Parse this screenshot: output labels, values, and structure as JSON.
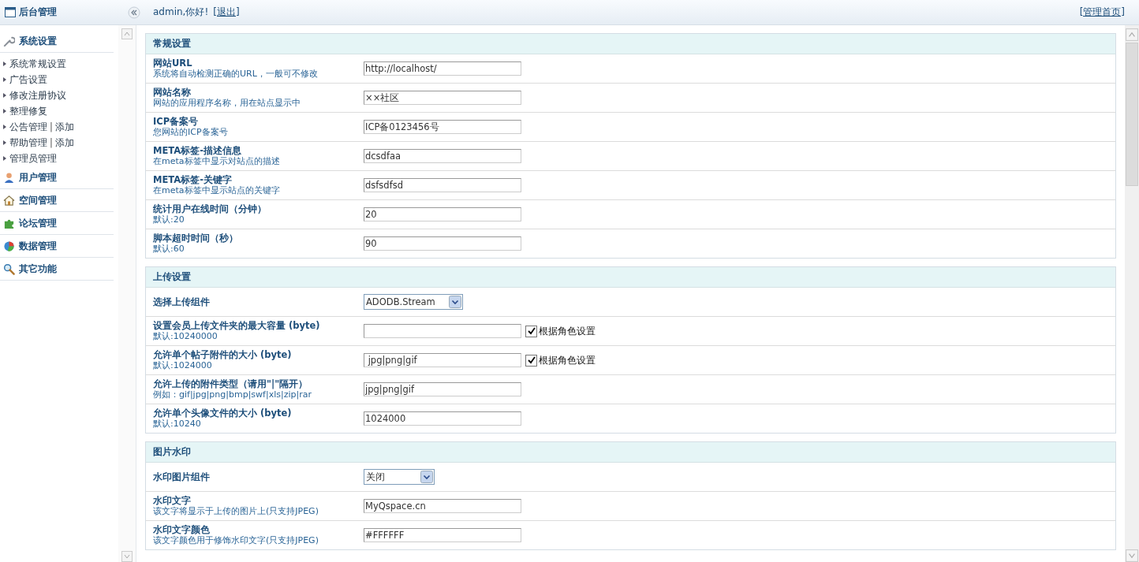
{
  "header": {
    "title": "后台管理",
    "greeting": "admin,你好!",
    "logout": "[退出]",
    "home_link": "[管理首页]"
  },
  "sidebar": [
    {
      "label": "系统设置",
      "children": [
        {
          "links": [
            "系统常规设置"
          ]
        },
        {
          "links": [
            "广告设置"
          ]
        },
        {
          "links": [
            "修改注册协议"
          ]
        },
        {
          "links": [
            "整理修复"
          ]
        },
        {
          "links": [
            "公告管理",
            "添加"
          ],
          "separator": "|"
        },
        {
          "links": [
            "帮助管理",
            "添加"
          ],
          "separator": "|"
        },
        {
          "links": [
            "管理员管理"
          ]
        }
      ]
    },
    {
      "label": "用户管理"
    },
    {
      "label": "空间管理"
    },
    {
      "label": "论坛管理"
    },
    {
      "label": "数据管理"
    },
    {
      "label": "其它功能"
    }
  ],
  "sections": [
    {
      "title": "常规设置",
      "rows": [
        {
          "label": "网站URL",
          "hint": "系统将自动检测正确的URL，一般可不修改",
          "kind": "text",
          "value": "http://localhost/"
        },
        {
          "label": "网站名称",
          "hint": "网站的应用程序名称，用在站点显示中",
          "kind": "text",
          "value": "××社区"
        },
        {
          "label": "ICP备案号",
          "hint": "您网站的ICP备案号",
          "kind": "text",
          "value": "ICP备0123456号"
        },
        {
          "label": "META标签-描述信息",
          "hint": "在meta标签中显示对站点的描述",
          "kind": "text",
          "value": "dcsdfaa"
        },
        {
          "label": "META标签-关键字",
          "hint": "在meta标签中显示站点的关键字",
          "kind": "text",
          "value": "dsfsdfsd"
        },
        {
          "label": "统计用户在线时间（分钟）",
          "hint": "默认:20",
          "kind": "text",
          "value": "20"
        },
        {
          "label": "脚本超时时间（秒）",
          "hint": "默认:60",
          "kind": "text",
          "value": "90"
        }
      ]
    },
    {
      "title": "上传设置",
      "rows": [
        {
          "label": "选择上传组件",
          "kind": "select",
          "value": "ADODB.Stream"
        },
        {
          "label": "设置会员上传文件夹的最大容量 (byte)",
          "hint": "默认:10240000",
          "kind": "text",
          "value": "",
          "checkbox": {
            "label": "根据角色设置",
            "checked": true
          }
        },
        {
          "label": "允许单个帖子附件的大小 (byte)",
          "hint": "默认:1024000",
          "kind": "text",
          "value": " jpg|png|gif",
          "checkbox": {
            "label": "根据角色设置",
            "checked": true
          }
        },
        {
          "label": "允许上传的附件类型（请用\"|\"隔开）",
          "hint": "例如：gif|jpg|png|bmp|swf|xls|zip|rar",
          "kind": "text",
          "value": "jpg|png|gif"
        },
        {
          "label": "允许单个头像文件的大小 (byte)",
          "hint": "默认:10240",
          "kind": "text",
          "value": "1024000"
        }
      ]
    },
    {
      "title": "图片水印",
      "rows": [
        {
          "label": "水印图片组件",
          "kind": "select",
          "value": "关闭"
        },
        {
          "label": "水印文字",
          "hint": "该文字将显示于上传的图片上(只支持JPEG)",
          "kind": "text",
          "value": "MyQspace.cn"
        },
        {
          "label": "水印文字颜色",
          "hint": "该文字颜色用于修饰水印文字(只支持JPEG)",
          "kind": "text",
          "value": "#FFFFFF"
        }
      ]
    }
  ]
}
